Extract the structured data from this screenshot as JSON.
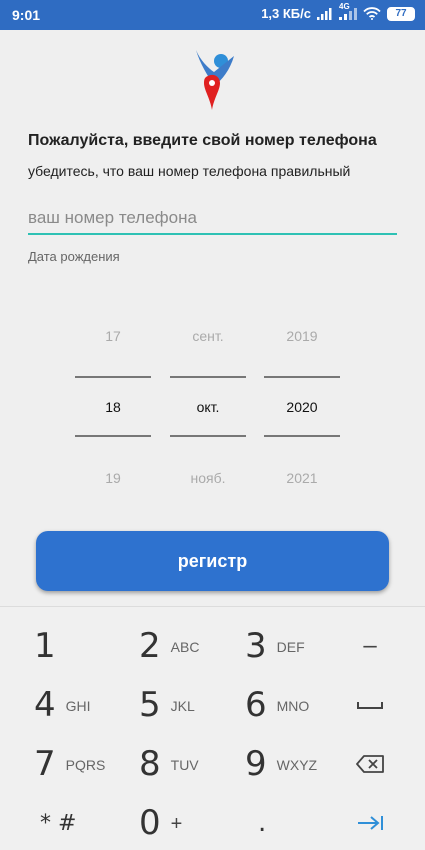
{
  "status_bar": {
    "time": "9:01",
    "network_speed": "1,3 КБ/с",
    "network_type": "4G",
    "battery": "77",
    "icons": [
      "signal-icon",
      "wifi-icon",
      "battery-icon"
    ]
  },
  "logo": {
    "icon": "person-location-logo",
    "colors": {
      "head": "#2f8fd8",
      "body": "#3d7cc9",
      "pin": "#e02020"
    }
  },
  "form": {
    "heading": "Пожалуйста, введите свой номер телефона",
    "subheading": "убедитесь, что ваш номер телефона правильный",
    "phone_value": "",
    "phone_placeholder": "ваш номер телефона",
    "dob_label": "Дата рождения"
  },
  "date_picker": {
    "day": {
      "prev": "17",
      "selected": "18",
      "next": "19"
    },
    "month": {
      "prev": "сент.",
      "selected": "окт.",
      "next": "нояб."
    },
    "year": {
      "prev": "2019",
      "selected": "2020",
      "next": "2021"
    }
  },
  "register_button": {
    "label": "регистр",
    "color": "#2e72cf"
  },
  "keypad": {
    "keys": [
      {
        "digit": "1",
        "letters": ""
      },
      {
        "digit": "2",
        "letters": "ABC"
      },
      {
        "digit": "3",
        "letters": "DEF"
      },
      {
        "digit": "4",
        "letters": "GHI"
      },
      {
        "digit": "5",
        "letters": "JKL"
      },
      {
        "digit": "6",
        "letters": "MNO"
      },
      {
        "digit": "7",
        "letters": "PQRS"
      },
      {
        "digit": "8",
        "letters": "TUV"
      },
      {
        "digit": "9",
        "letters": "WXYZ"
      },
      {
        "digit": "0",
        "letters": "+"
      }
    ],
    "star_hash": "* #",
    "dot": ".",
    "minus": "–",
    "side_icons": [
      "minus-icon",
      "space-icon",
      "backspace-icon",
      "next-icon"
    ],
    "accent": "#2f8fd8"
  }
}
